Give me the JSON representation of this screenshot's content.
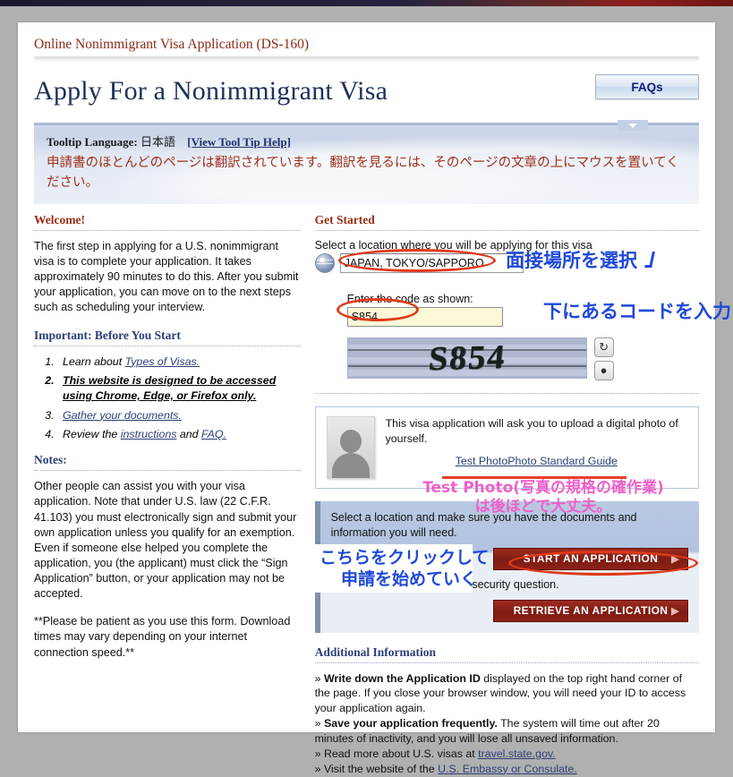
{
  "site": {
    "title": "Online Nonimmigrant Visa Application (DS-160)",
    "heading": "Apply For a Nonimmigrant Visa",
    "faq_button": "FAQs"
  },
  "tooltip": {
    "label": "Tooltip Language:",
    "language": "日本語",
    "help_link": "[View Tool Tip Help]",
    "message": "申請書のほとんどのページは翻訳されています。翻訳を見るには、そのページの文章の上にマウスを置いてください。"
  },
  "left": {
    "welcome_heading": "Welcome!",
    "welcome_body": "The first step in applying for a U.S. nonimmigrant visa is to complete your application. It takes approximately 90 minutes to do this. After you submit your application, you can move on to the next steps such as scheduling your interview.",
    "important_heading": "Important: Before You Start",
    "steps": [
      {
        "text_before": "Learn about ",
        "link": "Types of Visas.",
        "text_after": ""
      },
      {
        "text_before": "This website is designed to be accessed using Chrome, Edge, or Firefox only.",
        "link": "",
        "text_after": ""
      },
      {
        "text_before": "",
        "link": "Gather your documents.",
        "text_after": ""
      },
      {
        "text_before": "Review the ",
        "link": "instructions",
        "mid": " and ",
        "link2": "FAQ.",
        "text_after": ""
      }
    ],
    "notes_heading": "Notes:",
    "notes_body": "Other people can assist you with your visa application. Note that under U.S. law (22 C.F.R. 41.103) you must electronically sign and submit your own application unless you qualify for an exemption. Even if someone else helped you complete the application, you (the applicant) must click the “Sign Application” button, or your application may not be accepted.",
    "notes_body2": "**Please be patient as you use this form. Download times may vary depending on your internet connection speed.**"
  },
  "right": {
    "get_started_heading": "Get Started",
    "location_label": "Select a location where you will be applying for this visa",
    "location_value": "JAPAN, TOKYO/SAPPORO",
    "location_options": [
      "JAPAN, TOKYO/SAPPORO"
    ],
    "code_label": "Enter the code as shown:",
    "code_value": "S854",
    "code_placeholder": "",
    "captcha_text": "S854",
    "captcha_refresh_icon": "refresh-icon",
    "captcha_audio_icon": "audio-icon",
    "photo_text": "This visa application will ask you to upload a digital photo of yourself.",
    "photo_link_1": "Test Photo",
    "photo_link_2": "Photo Standard Guide",
    "action_text_1": "Select a location and make sure you have the documents and information you will need.",
    "start_button": "START AN APPLICATION",
    "action_text_2": "application ID and answer a security question.",
    "retrieve_button": "RETRIEVE AN APPLICATION",
    "arrow_glyph": "▶",
    "additional_heading": "Additional Information",
    "additional_items": [
      {
        "bullet": "»",
        "bold": "Write down the Application ID",
        "rest": " displayed on the top right hand corner of the page. If you close your browser window, you will need your ID to access your application again."
      },
      {
        "bullet": "»",
        "bold": "Save your application frequently.",
        "rest": " The system will time out after 20 minutes of inactivity, and you will lose all unsaved information."
      },
      {
        "bullet": "»",
        "bold": "",
        "rest": "Read more about U.S. visas at ",
        "link": "travel.state.gov."
      },
      {
        "bullet": "»",
        "bold": "",
        "rest": "Visit the website of the ",
        "link": "U.S. Embassy or Consulate."
      }
    ]
  },
  "annotations": {
    "location_note": "面接場所を選択",
    "code_note": "下にあるコードを入力",
    "photo_note_line1": "Test Photo(写真の規格の確作業)",
    "photo_note_line2": "は後ほどで大丈夫。",
    "start_note_line1": "こちらをクリックして",
    "start_note_line2": "申請を始めていく"
  },
  "colors": {
    "site_title_red": "#8a2a15",
    "heading_navy": "#1f3057",
    "annotation_blue": "#1f49d8",
    "annotation_pink": "#ef5fc8",
    "annotation_red": "#e03a1a",
    "button_red": "#8d2116"
  }
}
